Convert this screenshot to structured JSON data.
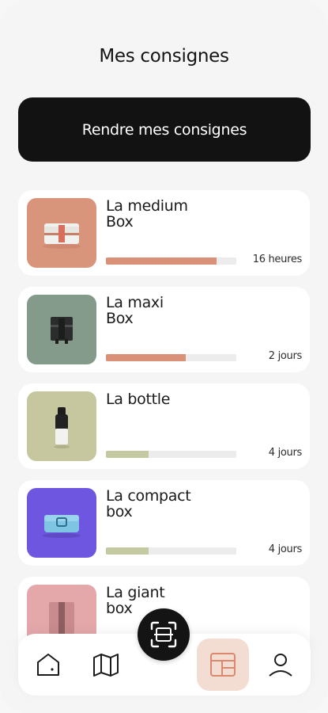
{
  "header": {
    "title": "Mes consignes"
  },
  "cta": {
    "label": "Rendre mes consignes"
  },
  "consignes": [
    {
      "name_line1": "La medium",
      "name_line2": "Box",
      "remaining": "16 heures",
      "progress": 0.85,
      "bar_color": "#d99278",
      "thumb_color": "#d9957c",
      "icon": "medium-box-icon"
    },
    {
      "name_line1": "La maxi",
      "name_line2": "Box",
      "remaining": "2 jours",
      "progress": 0.61,
      "bar_color": "#d99278",
      "thumb_color": "#849b8b",
      "icon": "maxi-box-icon"
    },
    {
      "name_line1": "La bottle",
      "name_line2": "",
      "remaining": "4 jours",
      "progress": 0.33,
      "bar_color": "#c4c9a1",
      "thumb_color": "#c6c79f",
      "icon": "bottle-icon"
    },
    {
      "name_line1": "La compact",
      "name_line2": "box",
      "remaining": "4 jours",
      "progress": 0.33,
      "bar_color": "#c4c9a1",
      "thumb_color": "#6f56e0",
      "icon": "compact-box-icon"
    },
    {
      "name_line1": "La giant",
      "name_line2": "box",
      "remaining": "",
      "progress": 0,
      "bar_color": "#c4c9a1",
      "thumb_color": "#e4a8ab",
      "icon": "giant-box-icon"
    }
  ],
  "nav": {
    "items": [
      {
        "icon": "home-icon"
      },
      {
        "icon": "map-icon"
      },
      {
        "icon": "scan-icon"
      },
      {
        "icon": "consignes-icon",
        "active": true
      },
      {
        "icon": "profile-icon"
      }
    ],
    "active_color": "#f3dcd1",
    "accent": "#d99278"
  }
}
